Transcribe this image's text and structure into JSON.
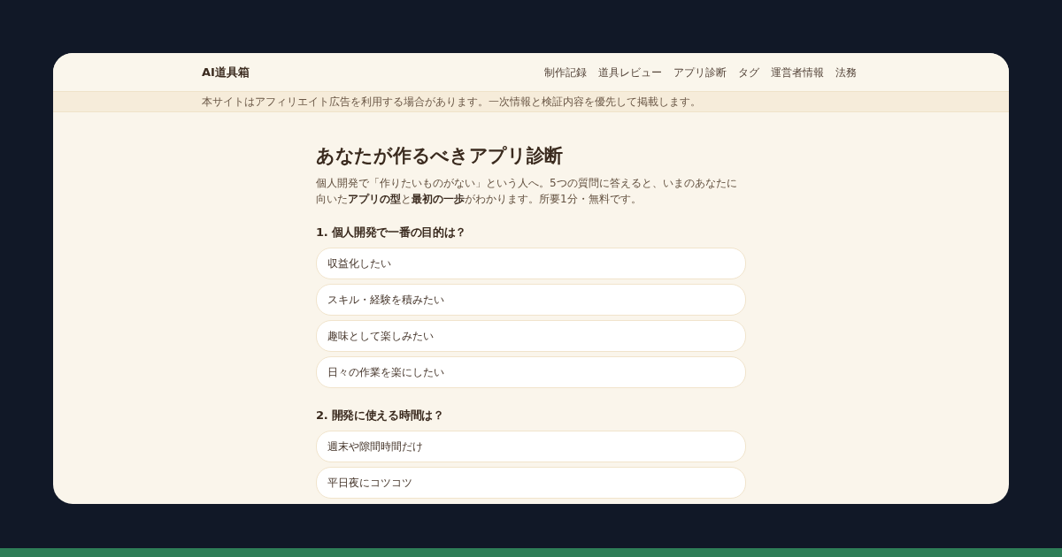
{
  "header": {
    "brand": "AI道具箱",
    "nav": [
      "制作記録",
      "道具レビュー",
      "アプリ診断",
      "タグ",
      "運営者情報",
      "法務"
    ]
  },
  "notice": "本サイトはアフィリエイト広告を利用する場合があります。一次情報と検証内容を優先して掲載します。",
  "page": {
    "title": "あなたが作るべきアプリ診断",
    "intro": "個人開発で「作りたいものがない」という人へ。5つの質問に答えると、いまのあなたに向いた**アプリの型**と**最初の一歩**がわかります。所要1分・無料です。",
    "questions": [
      {
        "heading": "1. 個人開発で一番の目的は？",
        "options": [
          {
            "label": "収益化したい",
            "selected": false
          },
          {
            "label": "スキル・経験を積みたい",
            "selected": false
          },
          {
            "label": "趣味として楽しみたい",
            "selected": false
          },
          {
            "label": "日々の作業を楽にしたい",
            "selected": false
          }
        ]
      },
      {
        "heading": "2. 開発に使える時間は？",
        "options": [
          {
            "label": "週末や隙間時間だけ",
            "selected": false
          },
          {
            "label": "平日夜にコツコツ",
            "selected": false
          }
        ]
      }
    ]
  }
}
